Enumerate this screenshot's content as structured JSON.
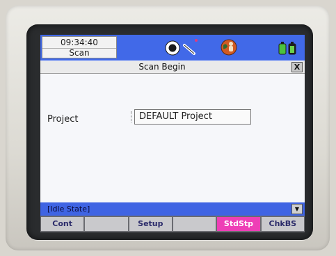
{
  "status": {
    "time": "09:34:40",
    "mode": "Scan",
    "icons": [
      "lens-icon",
      "wand-icon",
      "globe-person-icon",
      "battery-icon"
    ],
    "accent_color": "#4169e8"
  },
  "dialog": {
    "title": "Scan Begin",
    "close_label": "X"
  },
  "form": {
    "project_label": "Project",
    "project_value": "DEFAULT Project"
  },
  "statebar": {
    "text": "[Idle State]"
  },
  "softkeys": [
    {
      "label": "Cont",
      "active": false
    },
    {
      "label": "",
      "active": false
    },
    {
      "label": "Setup",
      "active": false
    },
    {
      "label": "",
      "active": false
    },
    {
      "label": "StdStp",
      "active": true
    },
    {
      "label": "ChkBS",
      "active": false
    }
  ],
  "colors": {
    "softkey_active": "#ee3fb6",
    "statebar": "#3f64e3"
  }
}
